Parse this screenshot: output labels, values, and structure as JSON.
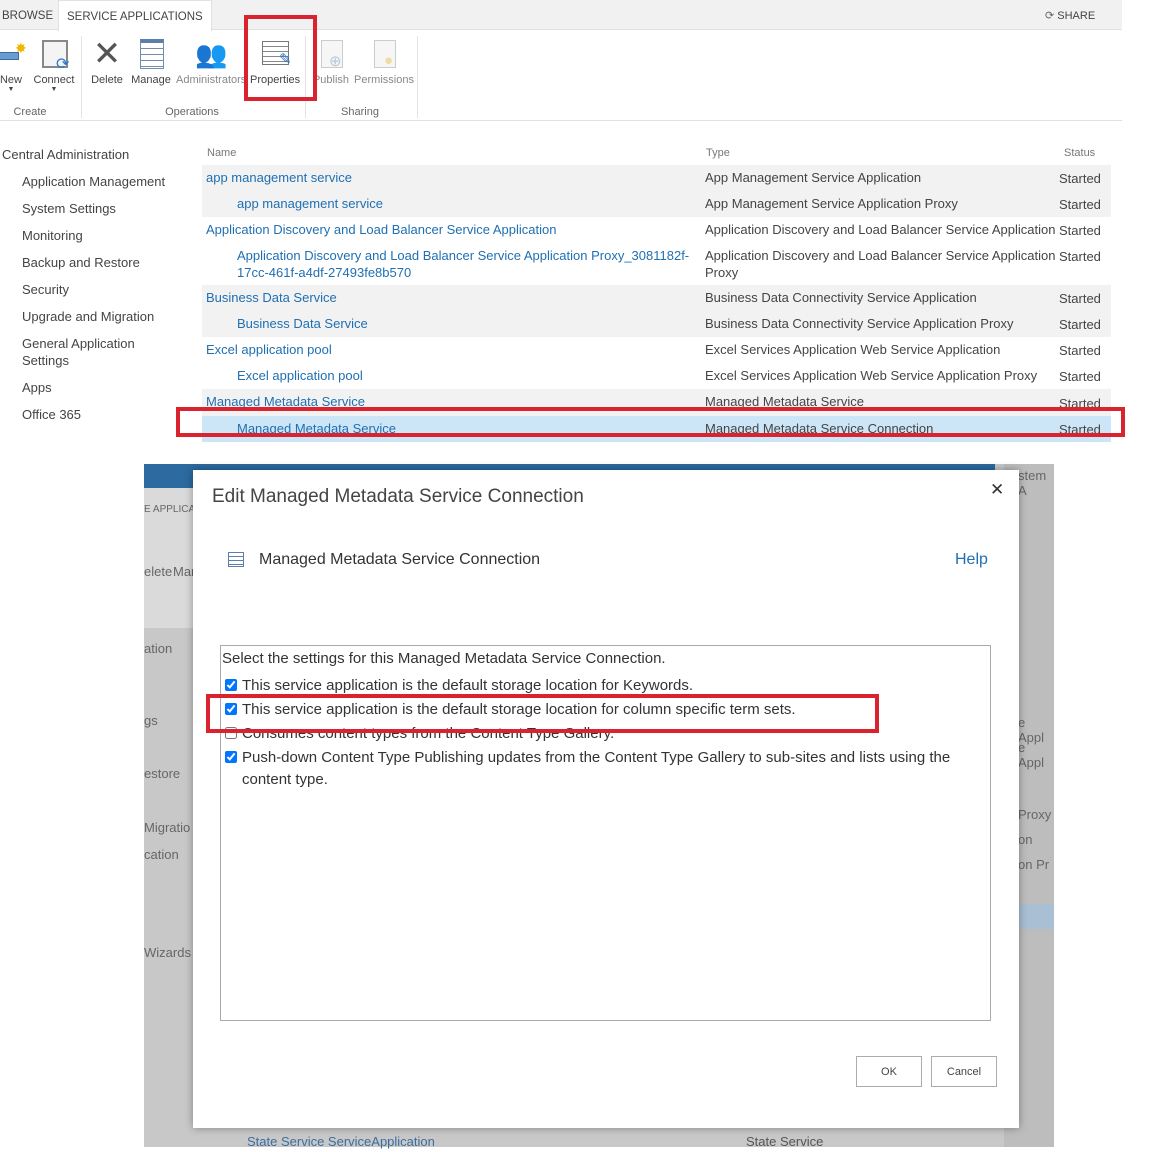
{
  "tabs": [
    {
      "label": "BROWSE"
    },
    {
      "label": "SERVICE APPLICATIONS"
    }
  ],
  "share_label": "SHARE",
  "ribbon": {
    "buttons": [
      {
        "label": "New",
        "icon": "new-icon"
      },
      {
        "label": "Connect",
        "icon": "connect-icon"
      },
      {
        "label": "Delete",
        "icon": "delete-x-icon"
      },
      {
        "label": "Manage",
        "icon": "manage-list-icon"
      },
      {
        "label": "Administrators",
        "icon": "administrators-icon"
      },
      {
        "label": "Properties",
        "icon": "properties-icon"
      },
      {
        "label": "Publish",
        "icon": "publish-icon"
      },
      {
        "label": "Permissions",
        "icon": "permissions-icon"
      }
    ],
    "groups": [
      "Create",
      "Operations",
      "Sharing"
    ]
  },
  "nav": {
    "title": "Central Administration",
    "items": [
      "Application Management",
      "System Settings",
      "Monitoring",
      "Backup and Restore",
      "Security",
      "Upgrade and Migration",
      "General Application Settings",
      "Apps",
      "Office 365"
    ]
  },
  "table": {
    "headers": [
      "Name",
      "Type",
      "Status"
    ],
    "rows": [
      {
        "name": "app management service",
        "type": "App Management Service Application",
        "status": "Started"
      },
      {
        "name": "app management service",
        "type": "App Management Service Application Proxy",
        "status": "Started"
      },
      {
        "name": "Application Discovery and Load Balancer Service Application",
        "type": "Application Discovery and Load Balancer Service Application",
        "status": "Started"
      },
      {
        "name": "Application Discovery and Load Balancer Service Application Proxy_3081182f-17cc-461f-a4df-27493fe8b570",
        "type": "Application Discovery and Load Balancer Service Application Proxy",
        "status": "Started"
      },
      {
        "name": "Business Data Service",
        "type": "Business Data Connectivity Service Application",
        "status": "Started"
      },
      {
        "name": "Business Data Service",
        "type": "Business Data Connectivity Service Application Proxy",
        "status": "Started"
      },
      {
        "name": "Excel application pool",
        "type": "Excel Services Application Web Service Application",
        "status": "Started"
      },
      {
        "name": "Excel application pool",
        "type": "Excel Services Application Web Service Application Proxy",
        "status": "Started"
      },
      {
        "name": "Managed Metadata Service",
        "type": "Managed Metadata Service",
        "status": "Started"
      },
      {
        "name": "Managed Metadata Service",
        "type": "Managed Metadata Service Connection",
        "status": "Started"
      }
    ]
  },
  "background_fragments": [
    "E APPLICAT",
    "elete",
    "Man",
    "ation",
    "gs",
    "estore",
    "Migratio",
    "cation",
    "Wizards",
    "stem A",
    "e Appl",
    "e Appl",
    "Proxy",
    "on",
    "on Pr",
    "State Service ServiceApplication",
    "State Service"
  ],
  "dialog": {
    "title": "Edit Managed Metadata Service Connection",
    "subheading": "Managed Metadata Service Connection",
    "help": "Help",
    "intro": "Select the settings for this Managed Metadata Service Connection.",
    "options": [
      {
        "label": "This service application is the default storage location for Keywords.",
        "checked": true
      },
      {
        "label": "This service application is the default storage location for column specific term sets.",
        "checked": true
      },
      {
        "label": "Consumes content types from the Content Type Gallery.",
        "checked": false
      },
      {
        "label": "Push-down Content Type Publishing updates from the Content Type Gallery to sub-sites and lists using the content type.",
        "checked": true
      }
    ],
    "ok": "OK",
    "cancel": "Cancel"
  },
  "colors": {
    "link": "#1f6fb2",
    "highlight": "#d9232f",
    "selected_row": "#cde6f7"
  }
}
